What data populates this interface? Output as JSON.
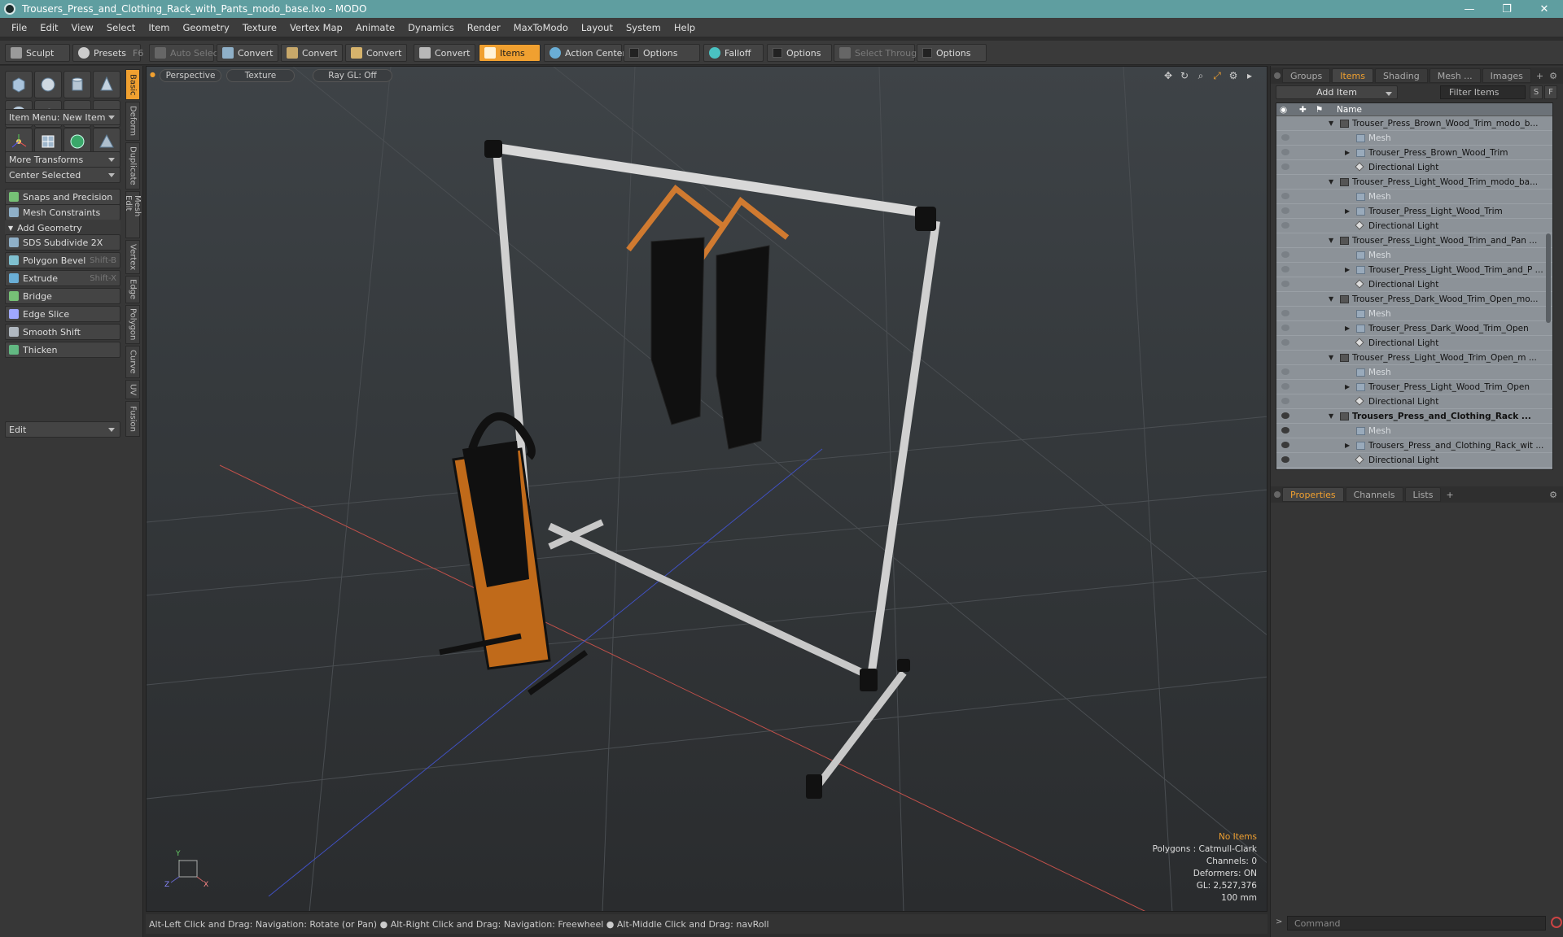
{
  "window": {
    "title": "Trousers_Press_and_Clothing_Rack_with_Pants_modo_base.lxo - MODO",
    "minimize": "—",
    "maximize": "❐",
    "close": "✕"
  },
  "menu": [
    "File",
    "Edit",
    "View",
    "Select",
    "Item",
    "Geometry",
    "Texture",
    "Vertex Map",
    "Animate",
    "Dynamics",
    "Render",
    "MaxToModo",
    "Layout",
    "System",
    "Help"
  ],
  "toolbar": {
    "sculpt": "Sculpt",
    "presets": "Presets",
    "presets_key": "F6",
    "auto_select": "Auto Select",
    "convert1": "Convert",
    "convert2": "Convert",
    "convert3": "Convert",
    "convert4": "Convert",
    "items": "Items",
    "action_center": "Action Center",
    "options1": "Options",
    "falloff": "Falloff",
    "options2": "Options",
    "select_through": "Select Through",
    "options3": "Options"
  },
  "left": {
    "item_menu": "Item Menu: New Item",
    "more_transforms": "More Transforms",
    "center_selected": "Center Selected",
    "snaps": "Snaps and Precision",
    "mesh_constraints": "Mesh Constraints",
    "add_geometry": "Add Geometry",
    "tools": [
      {
        "label": "SDS Subdivide 2X",
        "shortcut": ""
      },
      {
        "label": "Polygon Bevel",
        "shortcut": "Shift-B"
      },
      {
        "label": "Extrude",
        "shortcut": "Shift-X"
      },
      {
        "label": "Bridge",
        "shortcut": ""
      },
      {
        "label": "Edge Slice",
        "shortcut": ""
      },
      {
        "label": "Smooth Shift",
        "shortcut": ""
      },
      {
        "label": "Thicken",
        "shortcut": ""
      }
    ],
    "edit": "Edit",
    "vtabs": [
      "Basic",
      "Deform",
      "Duplicate",
      "Mesh Edit",
      "Vertex",
      "Edge",
      "Polygon",
      "Curve",
      "UV",
      "Fusion"
    ]
  },
  "viewport": {
    "perspective": "Perspective",
    "texture": "Texture",
    "raygl": "Ray GL: Off",
    "info": {
      "no_items": "No Items",
      "polygons": "Polygons : Catmull-Clark",
      "channels": "Channels: 0",
      "deformers": "Deformers: ON",
      "gl": "GL: 2,527,376",
      "scale": "100 mm"
    },
    "axis_x": "X",
    "axis_y": "Y",
    "axis_z": "Z"
  },
  "status": "Alt-Left Click and Drag: Navigation: Rotate (or Pan) ● Alt-Right Click and Drag: Navigation: Freewheel ● Alt-Middle Click and Drag: navRoll",
  "right": {
    "tabs": [
      "Groups",
      "Items",
      "Shading",
      "Mesh ...",
      "Images"
    ],
    "add_item": "Add Item",
    "filter": "Filter Items",
    "s": "S",
    "f": "F",
    "name_col": "Name",
    "tree": [
      {
        "label": "Trouser_Press_Brown_Wood_Trim_modo_b...",
        "type": "group",
        "depth": 0
      },
      {
        "label": "Mesh",
        "type": "mesh",
        "depth": 1
      },
      {
        "label": "Trouser_Press_Brown_Wood_Trim",
        "type": "mesh",
        "depth": 1
      },
      {
        "label": "Directional Light",
        "type": "light",
        "depth": 1
      },
      {
        "label": "Trouser_Press_Light_Wood_Trim_modo_ba...",
        "type": "group",
        "depth": 0
      },
      {
        "label": "Mesh",
        "type": "mesh",
        "depth": 1
      },
      {
        "label": "Trouser_Press_Light_Wood_Trim",
        "type": "mesh",
        "depth": 1
      },
      {
        "label": "Directional Light",
        "type": "light",
        "depth": 1
      },
      {
        "label": "Trouser_Press_Light_Wood_Trim_and_Pan ...",
        "type": "group",
        "depth": 0
      },
      {
        "label": "Mesh",
        "type": "mesh",
        "depth": 1
      },
      {
        "label": "Trouser_Press_Light_Wood_Trim_and_P ...",
        "type": "mesh",
        "depth": 1
      },
      {
        "label": "Directional Light",
        "type": "light",
        "depth": 1
      },
      {
        "label": "Trouser_Press_Dark_Wood_Trim_Open_mo...",
        "type": "group",
        "depth": 0
      },
      {
        "label": "Mesh",
        "type": "mesh",
        "depth": 1
      },
      {
        "label": "Trouser_Press_Dark_Wood_Trim_Open",
        "type": "mesh",
        "depth": 1
      },
      {
        "label": "Directional Light",
        "type": "light",
        "depth": 1
      },
      {
        "label": "Trouser_Press_Light_Wood_Trim_Open_m ...",
        "type": "group",
        "depth": 0
      },
      {
        "label": "Mesh",
        "type": "mesh",
        "depth": 1
      },
      {
        "label": "Trouser_Press_Light_Wood_Trim_Open",
        "type": "mesh",
        "depth": 1
      },
      {
        "label": "Directional Light",
        "type": "light",
        "depth": 1
      },
      {
        "label": "Trousers_Press_and_Clothing_Rack ...",
        "type": "group",
        "depth": 0
      },
      {
        "label": "Mesh",
        "type": "mesh",
        "depth": 1
      },
      {
        "label": "Trousers_Press_and_Clothing_Rack_wit ...",
        "type": "mesh",
        "depth": 1
      },
      {
        "label": "Directional Light",
        "type": "light",
        "depth": 1
      }
    ],
    "prop_tabs": [
      "Properties",
      "Channels",
      "Lists"
    ],
    "command": "Command"
  },
  "colors": {
    "accent": "#f0a030",
    "titlebar": "#5f9ea0"
  }
}
